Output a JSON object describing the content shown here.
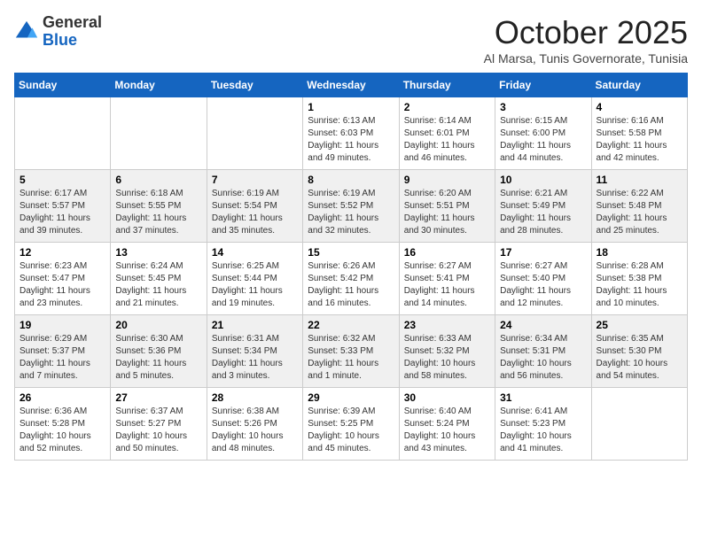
{
  "logo": {
    "general": "General",
    "blue": "Blue"
  },
  "header": {
    "month": "October 2025",
    "location": "Al Marsa, Tunis Governorate, Tunisia"
  },
  "weekdays": [
    "Sunday",
    "Monday",
    "Tuesday",
    "Wednesday",
    "Thursday",
    "Friday",
    "Saturday"
  ],
  "weeks": [
    [
      {
        "day": "",
        "info": ""
      },
      {
        "day": "",
        "info": ""
      },
      {
        "day": "",
        "info": ""
      },
      {
        "day": "1",
        "info": "Sunrise: 6:13 AM\nSunset: 6:03 PM\nDaylight: 11 hours\nand 49 minutes."
      },
      {
        "day": "2",
        "info": "Sunrise: 6:14 AM\nSunset: 6:01 PM\nDaylight: 11 hours\nand 46 minutes."
      },
      {
        "day": "3",
        "info": "Sunrise: 6:15 AM\nSunset: 6:00 PM\nDaylight: 11 hours\nand 44 minutes."
      },
      {
        "day": "4",
        "info": "Sunrise: 6:16 AM\nSunset: 5:58 PM\nDaylight: 11 hours\nand 42 minutes."
      }
    ],
    [
      {
        "day": "5",
        "info": "Sunrise: 6:17 AM\nSunset: 5:57 PM\nDaylight: 11 hours\nand 39 minutes."
      },
      {
        "day": "6",
        "info": "Sunrise: 6:18 AM\nSunset: 5:55 PM\nDaylight: 11 hours\nand 37 minutes."
      },
      {
        "day": "7",
        "info": "Sunrise: 6:19 AM\nSunset: 5:54 PM\nDaylight: 11 hours\nand 35 minutes."
      },
      {
        "day": "8",
        "info": "Sunrise: 6:19 AM\nSunset: 5:52 PM\nDaylight: 11 hours\nand 32 minutes."
      },
      {
        "day": "9",
        "info": "Sunrise: 6:20 AM\nSunset: 5:51 PM\nDaylight: 11 hours\nand 30 minutes."
      },
      {
        "day": "10",
        "info": "Sunrise: 6:21 AM\nSunset: 5:49 PM\nDaylight: 11 hours\nand 28 minutes."
      },
      {
        "day": "11",
        "info": "Sunrise: 6:22 AM\nSunset: 5:48 PM\nDaylight: 11 hours\nand 25 minutes."
      }
    ],
    [
      {
        "day": "12",
        "info": "Sunrise: 6:23 AM\nSunset: 5:47 PM\nDaylight: 11 hours\nand 23 minutes."
      },
      {
        "day": "13",
        "info": "Sunrise: 6:24 AM\nSunset: 5:45 PM\nDaylight: 11 hours\nand 21 minutes."
      },
      {
        "day": "14",
        "info": "Sunrise: 6:25 AM\nSunset: 5:44 PM\nDaylight: 11 hours\nand 19 minutes."
      },
      {
        "day": "15",
        "info": "Sunrise: 6:26 AM\nSunset: 5:42 PM\nDaylight: 11 hours\nand 16 minutes."
      },
      {
        "day": "16",
        "info": "Sunrise: 6:27 AM\nSunset: 5:41 PM\nDaylight: 11 hours\nand 14 minutes."
      },
      {
        "day": "17",
        "info": "Sunrise: 6:27 AM\nSunset: 5:40 PM\nDaylight: 11 hours\nand 12 minutes."
      },
      {
        "day": "18",
        "info": "Sunrise: 6:28 AM\nSunset: 5:38 PM\nDaylight: 11 hours\nand 10 minutes."
      }
    ],
    [
      {
        "day": "19",
        "info": "Sunrise: 6:29 AM\nSunset: 5:37 PM\nDaylight: 11 hours\nand 7 minutes."
      },
      {
        "day": "20",
        "info": "Sunrise: 6:30 AM\nSunset: 5:36 PM\nDaylight: 11 hours\nand 5 minutes."
      },
      {
        "day": "21",
        "info": "Sunrise: 6:31 AM\nSunset: 5:34 PM\nDaylight: 11 hours\nand 3 minutes."
      },
      {
        "day": "22",
        "info": "Sunrise: 6:32 AM\nSunset: 5:33 PM\nDaylight: 11 hours\nand 1 minute."
      },
      {
        "day": "23",
        "info": "Sunrise: 6:33 AM\nSunset: 5:32 PM\nDaylight: 10 hours\nand 58 minutes."
      },
      {
        "day": "24",
        "info": "Sunrise: 6:34 AM\nSunset: 5:31 PM\nDaylight: 10 hours\nand 56 minutes."
      },
      {
        "day": "25",
        "info": "Sunrise: 6:35 AM\nSunset: 5:30 PM\nDaylight: 10 hours\nand 54 minutes."
      }
    ],
    [
      {
        "day": "26",
        "info": "Sunrise: 6:36 AM\nSunset: 5:28 PM\nDaylight: 10 hours\nand 52 minutes."
      },
      {
        "day": "27",
        "info": "Sunrise: 6:37 AM\nSunset: 5:27 PM\nDaylight: 10 hours\nand 50 minutes."
      },
      {
        "day": "28",
        "info": "Sunrise: 6:38 AM\nSunset: 5:26 PM\nDaylight: 10 hours\nand 48 minutes."
      },
      {
        "day": "29",
        "info": "Sunrise: 6:39 AM\nSunset: 5:25 PM\nDaylight: 10 hours\nand 45 minutes."
      },
      {
        "day": "30",
        "info": "Sunrise: 6:40 AM\nSunset: 5:24 PM\nDaylight: 10 hours\nand 43 minutes."
      },
      {
        "day": "31",
        "info": "Sunrise: 6:41 AM\nSunset: 5:23 PM\nDaylight: 10 hours\nand 41 minutes."
      },
      {
        "day": "",
        "info": ""
      }
    ]
  ]
}
